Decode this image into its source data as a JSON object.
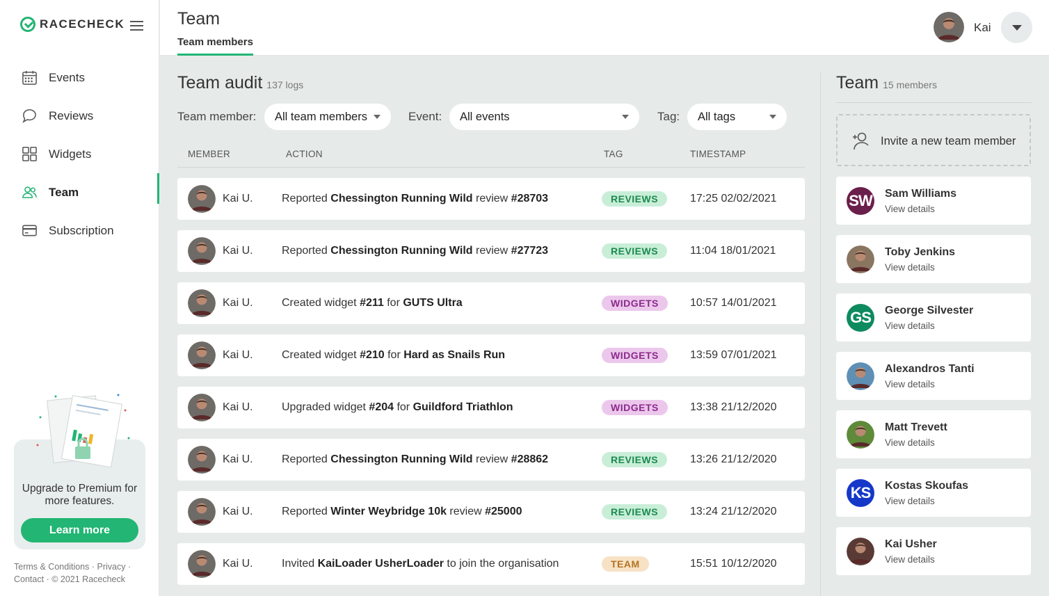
{
  "brand": {
    "name": "RACECHECK",
    "accent": "#22b573"
  },
  "sidebar": {
    "items": [
      {
        "label": "Events",
        "icon": "calendar-icon"
      },
      {
        "label": "Reviews",
        "icon": "speech-bubble-icon"
      },
      {
        "label": "Widgets",
        "icon": "grid-icon"
      },
      {
        "label": "Team",
        "icon": "users-icon",
        "active": true
      },
      {
        "label": "Subscription",
        "icon": "credit-card-icon"
      }
    ],
    "promo": {
      "text": "Upgrade to Premium for more features.",
      "button": "Learn more"
    },
    "footer": {
      "terms": "Terms & Conditions",
      "privacy": "Privacy",
      "contact": "Contact",
      "copyright": "© 2021 Racecheck"
    }
  },
  "header": {
    "title": "Team",
    "tab": "Team members",
    "user": {
      "name": "Kai"
    }
  },
  "audit": {
    "title": "Team audit",
    "count": "137 logs",
    "filters": {
      "member_label": "Team member:",
      "member_value": "All team members",
      "event_label": "Event:",
      "event_value": "All events",
      "tag_label": "Tag:",
      "tag_value": "All tags"
    },
    "columns": {
      "member": "MEMBER",
      "action": "ACTION",
      "tag": "TAG",
      "timestamp": "TIMESTAMP"
    },
    "rows": [
      {
        "member": "Kai U.",
        "parts": [
          "Reported ",
          "*Chessington Running Wild",
          " review ",
          "*#28703"
        ],
        "tag": "REVIEWS",
        "time": "17:25 02/02/2021"
      },
      {
        "member": "Kai U.",
        "parts": [
          "Reported ",
          "*Chessington Running Wild",
          " review ",
          "*#27723"
        ],
        "tag": "REVIEWS",
        "time": "11:04 18/01/2021"
      },
      {
        "member": "Kai U.",
        "parts": [
          "Created widget ",
          "*#211",
          " for ",
          "*GUTS Ultra"
        ],
        "tag": "WIDGETS",
        "time": "10:57 14/01/2021"
      },
      {
        "member": "Kai U.",
        "parts": [
          "Created widget ",
          "*#210",
          " for ",
          "*Hard as Snails Run"
        ],
        "tag": "WIDGETS",
        "time": "13:59 07/01/2021"
      },
      {
        "member": "Kai U.",
        "parts": [
          "Upgraded widget ",
          "*#204",
          " for ",
          "*Guildford Triathlon"
        ],
        "tag": "WIDGETS",
        "time": "13:38 21/12/2020"
      },
      {
        "member": "Kai U.",
        "parts": [
          "Reported ",
          "*Chessington Running Wild",
          " review ",
          "*#28862"
        ],
        "tag": "REVIEWS",
        "time": "13:26 21/12/2020"
      },
      {
        "member": "Kai U.",
        "parts": [
          "Reported ",
          "*Winter Weybridge 10k",
          " review ",
          "*#25000"
        ],
        "tag": "REVIEWS",
        "time": "13:24 21/12/2020"
      },
      {
        "member": "Kai U.",
        "parts": [
          "Invited ",
          "*KaiLoader UsherLoader",
          " to join the organisation"
        ],
        "tag": "TEAM",
        "time": "15:51 10/12/2020"
      }
    ]
  },
  "team": {
    "title": "Team",
    "count": "15 members",
    "invite_label": "Invite a new team member",
    "link_label": "View details",
    "members": [
      {
        "name": "Sam Williams",
        "initials": "SW",
        "color": "#6b1f4b"
      },
      {
        "name": "Toby Jenkins",
        "initials": "",
        "color": "#8a7560",
        "photo": "photo"
      },
      {
        "name": "George Silvester",
        "initials": "GS",
        "color": "#0e8a5f"
      },
      {
        "name": "Alexandros Tanti",
        "initials": "",
        "color": "#5f8fb5",
        "photo": "photo"
      },
      {
        "name": "Matt Trevett",
        "initials": "",
        "color": "#5e8a3a",
        "photo": "photo"
      },
      {
        "name": "Kostas Skoufas",
        "initials": "KS",
        "color": "#1538c9"
      },
      {
        "name": "Kai Usher",
        "initials": "",
        "color": "#5a3a34",
        "photo": "photo"
      }
    ]
  }
}
